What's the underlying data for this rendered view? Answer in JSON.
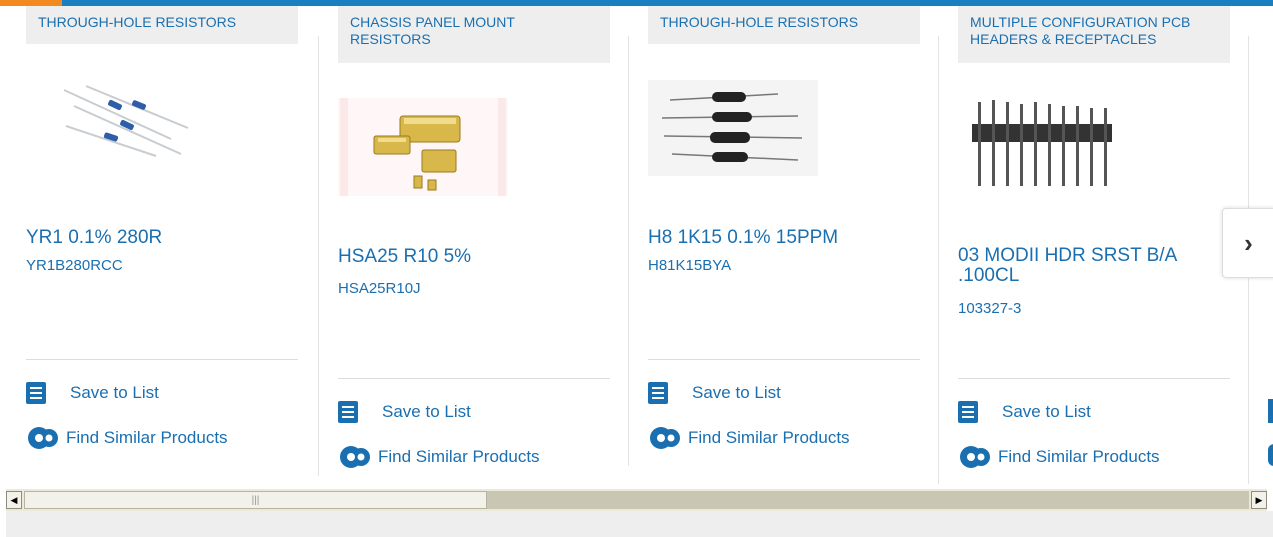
{
  "products": [
    {
      "category": "THROUGH-HOLE RESISTORS",
      "name": "YR1 0.1% 280R",
      "part_number": "YR1B280RCC",
      "save_label": "Save to List",
      "similar_label": "Find Similar Products"
    },
    {
      "category": "CHASSIS PANEL MOUNT RESISTORS",
      "name": "HSA25 R10 5%",
      "part_number": "HSA25R10J",
      "save_label": "Save to List",
      "similar_label": "Find Similar Products"
    },
    {
      "category": "THROUGH-HOLE RESISTORS",
      "name": "H8 1K15 0.1% 15PPM",
      "part_number": "H81K15BYA",
      "save_label": "Save to List",
      "similar_label": "Find Similar Products"
    },
    {
      "category": "MULTIPLE CONFIGURATION PCB HEADERS & RECEPTACLES",
      "name": "03 MODII HDR SRST B/A .100CL",
      "part_number": "103327-3",
      "save_label": "Save to List",
      "similar_label": "Find Similar Products"
    }
  ],
  "colors": {
    "brand_blue": "#1a6fb0",
    "top_bar": "#1a7fc1",
    "accent_orange": "#f28a1e"
  },
  "icons": {
    "next": "chevron-right-icon",
    "save": "checklist-icon",
    "similar": "gears-icon"
  },
  "next_label": "›"
}
